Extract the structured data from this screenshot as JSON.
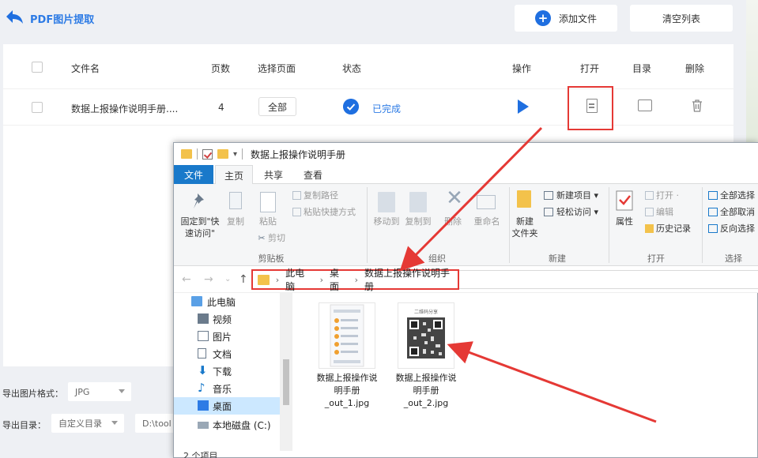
{
  "app": {
    "title": "PDF图片提取",
    "add_file": "添加文件",
    "clear_list": "清空列表",
    "columns": {
      "filename": "文件名",
      "pages": "页数",
      "select_pages": "选择页面",
      "status": "状态",
      "action": "操作",
      "open": "打开",
      "directory": "目录",
      "delete": "删除"
    },
    "rows": [
      {
        "filename": "数据上报操作说明手册....",
        "pages": "4",
        "range": "全部",
        "status": "已完成"
      }
    ],
    "format_label": "导出图片格式：",
    "format_value": "JPG",
    "dir_label": "导出目录：",
    "dir_value": "自定义目录",
    "path_value": "D:\\tool"
  },
  "explorer": {
    "title": "数据上报操作说明手册",
    "tabs": [
      "文件",
      "主页",
      "共享",
      "查看"
    ],
    "ribbon": {
      "pin": "固定到\"快\n速访问\"",
      "copy": "复制",
      "paste": "粘贴",
      "copy_path": "复制路径",
      "paste_shortcut": "粘贴快捷方式",
      "cut": "剪切",
      "clipboard": "剪贴板",
      "move_to": "移动到",
      "copy_to": "复制到",
      "delete": "删除",
      "rename": "重命名",
      "organize": "组织",
      "new_folder": "新建\n文件夹",
      "new_item": "新建项目 ▾",
      "easy_access": "轻松访问 ▾",
      "new": "新建",
      "properties": "属性",
      "open": "打开 ·",
      "edit": "编辑",
      "history": "历史记录",
      "open_group": "打开",
      "select_all": "全部选择",
      "select_none": "全部取消",
      "invert": "反向选择",
      "select": "选择"
    },
    "address": {
      "this_pc": "此电脑",
      "desktop": "桌面",
      "folder": "数据上报操作说明手册"
    },
    "nav": [
      {
        "label": "此电脑",
        "icon": "monitor-icon"
      },
      {
        "label": "视频",
        "icon": "video-icon"
      },
      {
        "label": "图片",
        "icon": "picture-icon"
      },
      {
        "label": "文档",
        "icon": "document-icon"
      },
      {
        "label": "下载",
        "icon": "download-icon"
      },
      {
        "label": "音乐",
        "icon": "music-icon"
      },
      {
        "label": "桌面",
        "icon": "desktop-icon"
      },
      {
        "label": "本地磁盘 (C:)",
        "icon": "disk-icon"
      }
    ],
    "files": [
      {
        "name": "数据上报操作说\n明手册\n_out_1.jpg"
      },
      {
        "name": "数据上报操作说\n明手册\n_out_2.jpg",
        "caption": "二维码分享"
      }
    ],
    "status": "2 个项目"
  },
  "colors": {
    "accent": "#1f6fe0",
    "highlight": "#e53935",
    "folder": "#f3c24b"
  }
}
